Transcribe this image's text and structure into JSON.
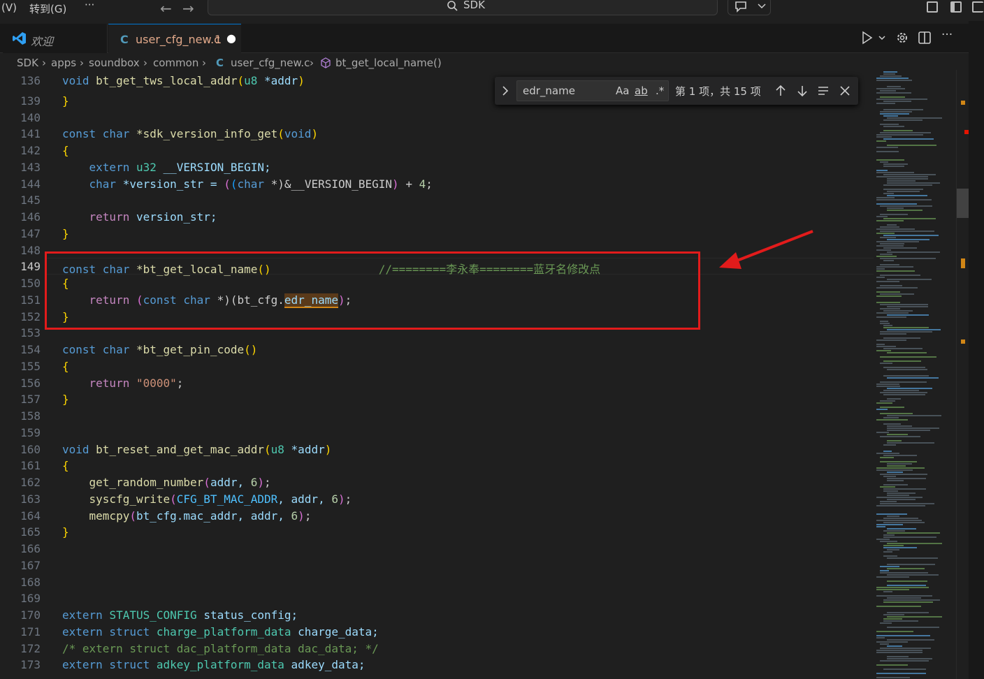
{
  "titlebar": {
    "menu_view": "(V)",
    "menu_goto": "转到(G)",
    "more": "···",
    "back": "←",
    "forward": "→",
    "search_text": "SDK"
  },
  "tabs": [
    {
      "label": "欢迎",
      "active": false
    },
    {
      "label": "user_cfg_new.c",
      "badge": "1",
      "modified": "●",
      "active": true
    }
  ],
  "breadcrumb": [
    "SDK",
    "apps",
    "soundbox",
    "common",
    "user_cfg_new.c",
    "bt_get_local_name()"
  ],
  "find_widget": {
    "query": "edr_name",
    "match_case": "Aa",
    "whole_word": "ab",
    "regex": ".*",
    "result": "第 1 项，共 15 项"
  },
  "line_numbers": [
    "136",
    "139",
    "140",
    "141",
    "142",
    "143",
    "144",
    "145",
    "146",
    "147",
    "148",
    "149",
    "150",
    "151",
    "152",
    "153",
    "154",
    "155",
    "156",
    "157",
    "158",
    "159",
    "160",
    "161",
    "162",
    "163",
    "164",
    "165",
    "166",
    "167",
    "168",
    "169",
    "170",
    "171",
    "172",
    "173"
  ],
  "current_line": "149",
  "code": {
    "l136a": "void",
    "l136b": "bt_get_tws_local_addr",
    "l136c": "u8",
    "l136d": "*addr",
    "l141a": "const char",
    "l141b": "*sdk_version_info_get",
    "l141c": "void",
    "l143a": "extern",
    "l143b": "u32",
    "l143c": "__VERSION_BEGIN;",
    "l144a": "char",
    "l144b": "*version_str = ",
    "l144c": "char",
    "l144d": " *)&__VERSION_BEGIN",
    "l144e": " + ",
    "l144f": "4",
    "l146a": "return",
    "l146b": "version_str;",
    "l149a": "const char",
    "l149b": "*bt_get_local_name",
    "l149c": "//========李永奉========蓝牙名修改点",
    "l151a": "return",
    "l151b": "const char",
    "l151c": " *)(bt_cfg.",
    "l151d": "edr_name",
    "l154a": "const char",
    "l154b": "*bt_get_pin_code",
    "l156a": "return",
    "l156b": "\"0000\"",
    "l160a": "void",
    "l160b": "bt_reset_and_get_mac_addr",
    "l160c": "u8",
    "l160d": "*addr",
    "l162a": "get_random_number",
    "l162b": "addr, ",
    "l162c": "6",
    "l163a": "syscfg_write",
    "l163b": "CFG_BT_MAC_ADDR",
    "l163c": ", addr, ",
    "l163d": "6",
    "l164a": "memcpy",
    "l164b": "bt_cfg.mac_addr, addr, ",
    "l164c": "6",
    "l170a": "extern",
    "l170b": "STATUS_CONFIG",
    "l170c": "status_config;",
    "l171a": "extern struct",
    "l171b": "charge_platform_data",
    "l171c": "charge_data;",
    "l172": "/* extern struct dac_platform_data dac_data; */",
    "l173a": "extern struct",
    "l173b": "adkey_platform_data",
    "l173c": "adkey_data;"
  },
  "colors": {
    "annotation": "#e21b1b",
    "accent": "#0078d4",
    "find_highlight": "#d18616"
  }
}
